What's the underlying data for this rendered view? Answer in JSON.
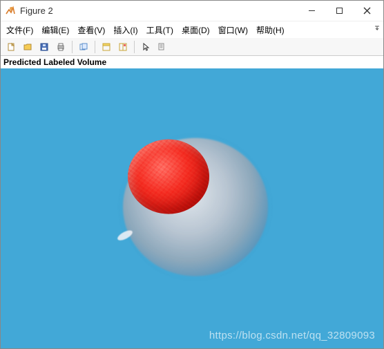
{
  "window": {
    "title": "Figure 2"
  },
  "menu": {
    "file": "文件(F)",
    "edit": "编辑(E)",
    "view": "查看(V)",
    "insert": "插入(I)",
    "tools": "工具(T)",
    "desktop": "桌面(D)",
    "window": "窗口(W)",
    "help": "帮助(H)"
  },
  "toolbar_icons": {
    "new": "new-file-icon",
    "open": "open-folder-icon",
    "save": "save-icon",
    "print": "print-icon",
    "copy": "copy-figure-icon",
    "dock": "dock-icon",
    "layout": "layout-icon",
    "pointer": "pointer-icon",
    "inspect": "inspect-icon"
  },
  "plot": {
    "title": "Predicted Labeled Volume",
    "bg_color": "#42a8d7",
    "label_colors": {
      "region_1": "#e22118",
      "region_2": "#c8ccd2"
    }
  },
  "watermark": "https://blog.csdn.net/qq_32809093"
}
